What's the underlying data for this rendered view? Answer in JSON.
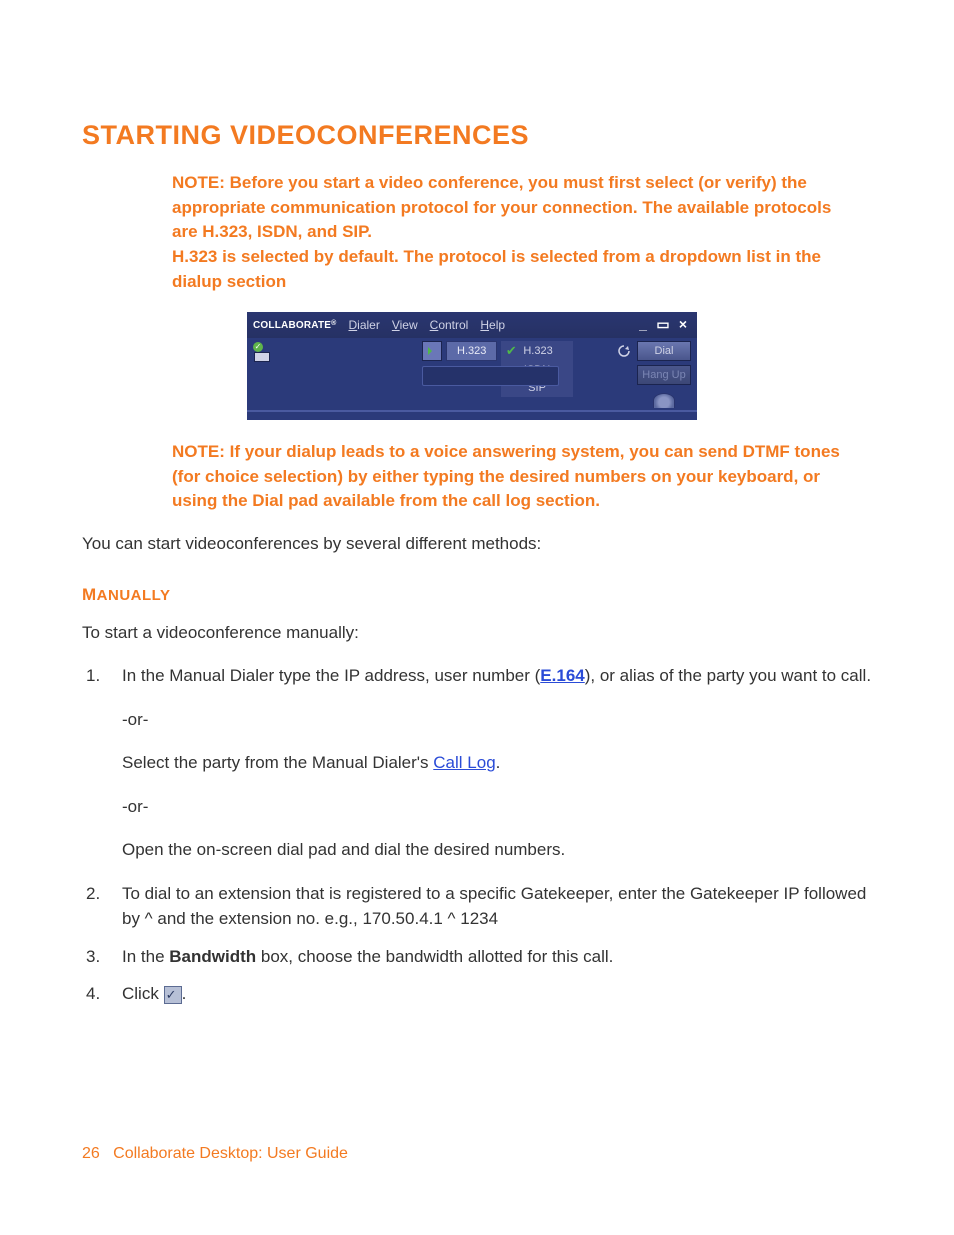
{
  "heading": "STARTING VIDEOCONFERENCES",
  "note1_lines": [
    "NOTE: Before you start a video conference, you must first select (or verify) the appropriate communication protocol for your connection. The available protocols are H.323, ISDN, and SIP.",
    "H.323 is selected by default. The protocol is selected from a dropdown list in the dialup section"
  ],
  "note2": "NOTE: If your dialup leads to a voice answering system, you can send DTMF tones (for choice selection) by either typing the desired numbers on your keyboard, or using the Dial pad available from the call log section.",
  "intro": "You can start videoconferences by several different methods:",
  "manually_heading_first": "M",
  "manually_heading_rest": "ANUALLY",
  "manually_intro": "To start a videoconference manually:",
  "step1_a": "In the Manual Dialer type the IP address, user number (",
  "step1_link": "E.164",
  "step1_b": "), or alias of the party you want to call.",
  "or": "-or-",
  "step1_alt1_a": "Select the party from the Manual Dialer's ",
  "step1_alt1_link": "Call Log",
  "step1_alt1_b": ".",
  "step1_alt2": "Open the on-screen dial pad and dial the desired numbers.",
  "step2": "To dial to an extension that is registered to a specific Gatekeeper, enter the Gatekeeper IP followed by  ^  and the extension no. e.g., 170.50.4.1 ^ 1234",
  "step3_a": "In the ",
  "step3_bold": "Bandwidth",
  "step3_b": " box, choose the bandwidth allotted for this call.",
  "step4_a": "Click ",
  "step4_b": ".",
  "footer_page": "26",
  "footer_title": "Collaborate Desktop: User Guide",
  "app": {
    "logo": "COLLABORATE",
    "menu": {
      "dialer": "Dialer",
      "view": "View",
      "control": "Control",
      "help": "Help"
    },
    "protocol_selected": "H.323",
    "protocol_options": {
      "h323": "H.323",
      "isdn": "ISDN",
      "sip": "SIP"
    },
    "buttons": {
      "dial": "Dial",
      "hangup": "Hang Up"
    }
  }
}
